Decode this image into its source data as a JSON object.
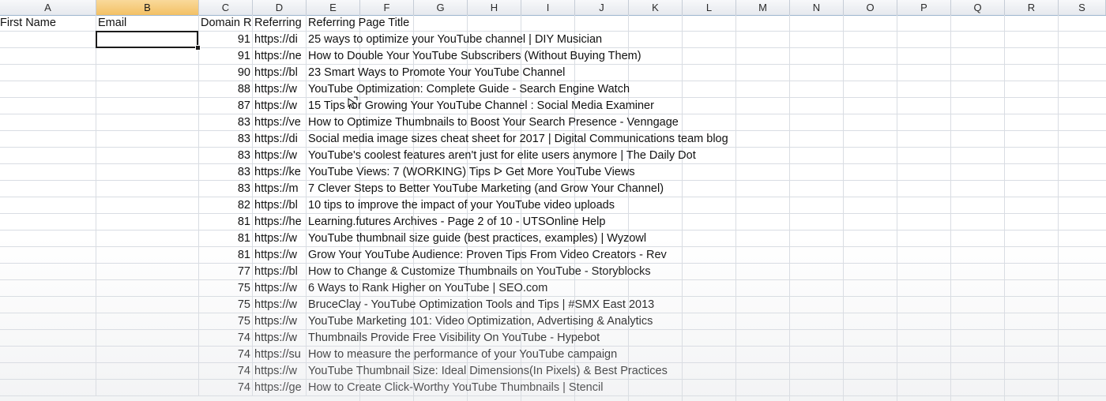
{
  "columns": [
    "A",
    "B",
    "C",
    "D",
    "E",
    "F",
    "G",
    "H",
    "I",
    "J",
    "K",
    "L",
    "M",
    "N",
    "O",
    "P",
    "Q",
    "R",
    "S"
  ],
  "selected_column": "B",
  "header_row": {
    "first_name": "First Name",
    "email": "Email",
    "domain_rating": "Domain Ra",
    "referring_url": "Referring",
    "referring_title": "Referring Page Title"
  },
  "rows": [
    {
      "rating": "91",
      "url": "https://di",
      "title": "25 ways to optimize your YouTube channel | DIY Musician"
    },
    {
      "rating": "91",
      "url": "https://ne",
      "title": "How to Double Your YouTube Subscribers (Without Buying Them)"
    },
    {
      "rating": "90",
      "url": "https://bl",
      "title": "23 Smart Ways to Promote Your YouTube Channel"
    },
    {
      "rating": "88",
      "url": "https://w",
      "title": "YouTube Optimization: Complete Guide - Search Engine Watch"
    },
    {
      "rating": "87",
      "url": "https://w",
      "title": "15 Tips for Growing Your YouTube Channel : Social Media Examiner"
    },
    {
      "rating": "83",
      "url": "https://ve",
      "title": "How to Optimize Thumbnails to Boost Your Search Presence - Venngage"
    },
    {
      "rating": "83",
      "url": "https://di",
      "title": "Social media image sizes cheat sheet for 2017 | Digital Communications team blog"
    },
    {
      "rating": "83",
      "url": "https://w",
      "title": "YouTube's coolest features aren't just for elite users anymore | The Daily Dot"
    },
    {
      "rating": "83",
      "url": "https://ke",
      "title": "YouTube Views: 7 (WORKING) Tips ᐅ Get More YouTube Views"
    },
    {
      "rating": "83",
      "url": "https://m",
      "title": "7 Clever Steps to Better YouTube Marketing (and Grow Your Channel)"
    },
    {
      "rating": "82",
      "url": "https://bl",
      "title": "10 tips to improve the impact of your YouTube video uploads"
    },
    {
      "rating": "81",
      "url": "https://he",
      "title": "Learning.futures Archives - Page 2 of 10 - UTSOnline Help"
    },
    {
      "rating": "81",
      "url": "https://w",
      "title": "YouTube thumbnail size guide (best practices, examples) | Wyzowl"
    },
    {
      "rating": "81",
      "url": "https://w",
      "title": "Grow Your YouTube Audience: Proven Tips From Video Creators - Rev"
    },
    {
      "rating": "77",
      "url": "https://bl",
      "title": "How to Change & Customize Thumbnails on YouTube - Storyblocks"
    },
    {
      "rating": "75",
      "url": "https://w",
      "title": "6 Ways to Rank Higher on YouTube | SEO.com"
    },
    {
      "rating": "75",
      "url": "https://w",
      "title": "BruceClay - YouTube Optimization Tools and Tips | #SMX East 2013"
    },
    {
      "rating": "75",
      "url": "https://w",
      "title": "YouTube Marketing 101: Video Optimization, Advertising & Analytics"
    },
    {
      "rating": "74",
      "url": "https://w",
      "title": "Thumbnails Provide Free Visibility On YouTube - Hypebot"
    },
    {
      "rating": "74",
      "url": "https://su",
      "title": "How to measure the performance of your YouTube campaign"
    },
    {
      "rating": "74",
      "url": "https://w",
      "title": "YouTube Thumbnail Size: Ideal Dimensions(In Pixels) & Best Practices"
    },
    {
      "rating": "74",
      "url": "https://ge",
      "title": "How to Create Click-Worthy YouTube Thumbnails | Stencil"
    }
  ]
}
